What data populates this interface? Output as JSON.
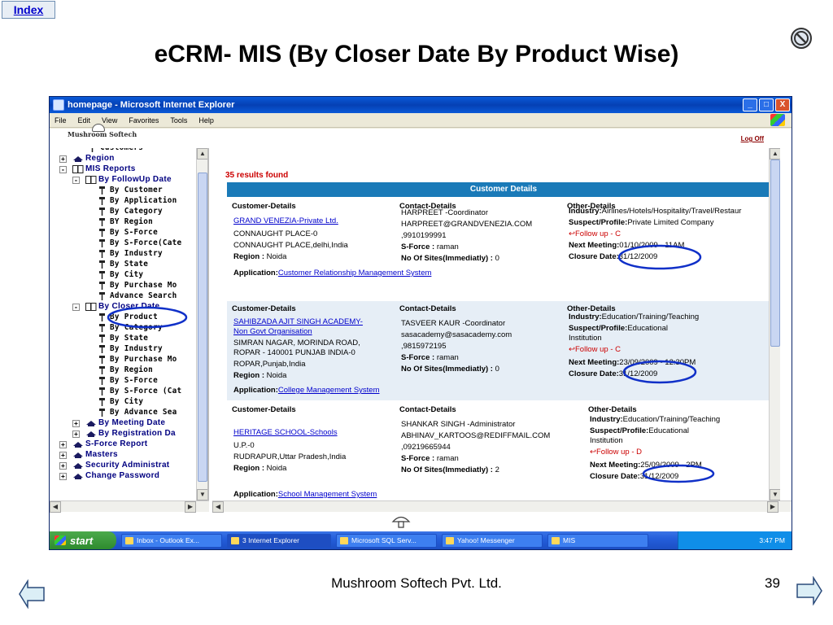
{
  "slide": {
    "index_label": "Index",
    "title": "eCRM- MIS (By Closer Date By Product Wise)",
    "footer_company": "Mushroom Softech Pvt. Ltd.",
    "page_number": "39"
  },
  "browser": {
    "window_title": "homepage - Microsoft Internet Explorer",
    "menu": [
      "File",
      "Edit",
      "View",
      "Favorites",
      "Tools",
      "Help"
    ],
    "window_buttons": [
      "_",
      "□",
      "X"
    ]
  },
  "app": {
    "logo_text": "Mushroom Softech",
    "logout_label": "Log Off"
  },
  "tree": [
    {
      "label": "Customers",
      "level": "leaf",
      "indent": 60,
      "type": "leaf"
    },
    {
      "label": "Region",
      "level": "lvl1",
      "indent": 28,
      "type": "node",
      "exp": "+"
    },
    {
      "label": "MIS Reports",
      "level": "lvl1",
      "indent": 28,
      "type": "book",
      "exp": "-"
    },
    {
      "label": "By FollowUp Date",
      "level": "lvl2",
      "indent": 44,
      "type": "book",
      "exp": "-"
    },
    {
      "label": "By Customer",
      "level": "leaf",
      "indent": 72,
      "type": "leaf"
    },
    {
      "label": "By Application",
      "level": "leaf",
      "indent": 72,
      "type": "leaf"
    },
    {
      "label": "By Category",
      "level": "leaf",
      "indent": 72,
      "type": "leaf"
    },
    {
      "label": "BY Region",
      "level": "leaf",
      "indent": 72,
      "type": "leaf"
    },
    {
      "label": "By S-Force",
      "level": "leaf",
      "indent": 72,
      "type": "leaf"
    },
    {
      "label": "By S-Force(Cate",
      "level": "leaf",
      "indent": 72,
      "type": "leaf"
    },
    {
      "label": "By Industry",
      "level": "leaf",
      "indent": 72,
      "type": "leaf"
    },
    {
      "label": "By State",
      "level": "leaf",
      "indent": 72,
      "type": "leaf"
    },
    {
      "label": "By City",
      "level": "leaf",
      "indent": 72,
      "type": "leaf"
    },
    {
      "label": "By Purchase Mo",
      "level": "leaf",
      "indent": 72,
      "type": "leaf"
    },
    {
      "label": "Advance Search",
      "level": "leaf",
      "indent": 72,
      "type": "leaf"
    },
    {
      "label": "By Closer Date",
      "level": "lvl2",
      "indent": 44,
      "type": "book",
      "exp": "-"
    },
    {
      "label": "By Product",
      "level": "leaf",
      "indent": 72,
      "type": "leaf"
    },
    {
      "label": "By Category",
      "level": "leaf",
      "indent": 72,
      "type": "leaf"
    },
    {
      "label": "By State",
      "level": "leaf",
      "indent": 72,
      "type": "leaf"
    },
    {
      "label": "By Industry",
      "level": "leaf",
      "indent": 72,
      "type": "leaf"
    },
    {
      "label": "By Purchase Mo",
      "level": "leaf",
      "indent": 72,
      "type": "leaf"
    },
    {
      "label": "By Region",
      "level": "leaf",
      "indent": 72,
      "type": "leaf"
    },
    {
      "label": "By S-Force",
      "level": "leaf",
      "indent": 72,
      "type": "leaf"
    },
    {
      "label": "By S-Force (Cat",
      "level": "leaf",
      "indent": 72,
      "type": "leaf"
    },
    {
      "label": "By City",
      "level": "leaf",
      "indent": 72,
      "type": "leaf"
    },
    {
      "label": "By Advance Sea",
      "level": "leaf",
      "indent": 72,
      "type": "leaf"
    },
    {
      "label": "By Meeting Date",
      "level": "lvl2",
      "indent": 44,
      "type": "node",
      "exp": "+"
    },
    {
      "label": "By Registration Da",
      "level": "lvl2",
      "indent": 44,
      "type": "node",
      "exp": "+"
    },
    {
      "label": "S-Force Report",
      "level": "lvl1",
      "indent": 28,
      "type": "node",
      "exp": "+"
    },
    {
      "label": "Masters",
      "level": "lvl1",
      "indent": 28,
      "type": "node",
      "exp": "+"
    },
    {
      "label": "Security Administrat",
      "level": "lvl1",
      "indent": 28,
      "type": "node",
      "exp": "+"
    },
    {
      "label": "Change Password",
      "level": "lvl1",
      "indent": 28,
      "type": "node",
      "exp": "+"
    }
  ],
  "content": {
    "results_text": "35 results found",
    "table_header": "Customer Details",
    "col_customer": "Customer-Details",
    "col_contact": "Contact-Details",
    "col_other": "Other-Details",
    "lbl_region": "Region :",
    "lbl_sforce": "S-Force :",
    "lbl_sites": "No Of Sites(Immediatly) :",
    "lbl_industry": "Industry:",
    "lbl_suspect": "Suspect/Profile:",
    "lbl_follow": "Follow up",
    "lbl_next": "Next Meeting:",
    "lbl_closure": "Closure Date:",
    "lbl_application": "Application:",
    "records": [
      {
        "company": "GRAND VENEZIA-Private Ltd.",
        "address1": "CONNAUGHT PLACE-0",
        "address2": "CONNAUGHT PLACE,delhi,India",
        "address3": "",
        "region": "Noida",
        "contact_name": "HARPREET -Coordinator",
        "email": "HARPREET@GRANDVENEZIA.COM",
        "phone": ",9910199991",
        "sforce": "raman",
        "sites": "0",
        "industry": "Airlines/Hotels/Hospitality/Travel/Restaur",
        "suspect": "Private Limited Company",
        "follow_grade": "- C",
        "next_meeting": "01/10/2009 - 11AM",
        "closure_date": "31/12/2009",
        "application": "Customer Relationship Management System"
      },
      {
        "company": "SAHIBZADA AJIT SINGH ACADEMY-",
        "company2": "Non Govt Organisation",
        "address1": "SIMRAN NAGAR, MORINDA ROAD,",
        "address2": "ROPAR - 140001 PUNJAB INDIA-0",
        "address3": "ROPAR,Punjab,India",
        "region": "Noida",
        "contact_name": "TASVEER KAUR -Coordinator",
        "email": "sasacademy@sasacademy.com",
        "phone": ",9815972195",
        "sforce": "raman",
        "sites": "0",
        "industry": "Education/Training/Teaching",
        "suspect": "Educational",
        "suspect2": "Institution",
        "follow_grade": "- C",
        "next_meeting": "23/09/2009 - 12:30PM",
        "closure_date": "31/12/2009",
        "application": "College Management System"
      },
      {
        "company": "HERITAGE SCHOOL-Schools",
        "address1": "U.P.-0",
        "address2": "RUDRAPUR,Uttar Pradesh,India",
        "address3": "",
        "region": "Noida",
        "contact_name": "SHANKAR SINGH -Administrator",
        "email": "ABHINAV_KARTOOS@REDIFFMAIL.COM",
        "phone": ",09219665944",
        "sforce": "raman",
        "sites": "2",
        "industry": "Education/Training/Teaching",
        "suspect": "Educational",
        "suspect2": "Institution",
        "follow_grade": "- D",
        "next_meeting": "25/09/2009 - 2PM",
        "closure_date": "31/12/2009",
        "application": "School Management System"
      }
    ]
  },
  "taskbar": {
    "start_label": "start",
    "tasks": [
      "Inbox - Outlook Ex...",
      "3 Internet Explorer",
      "Microsoft SQL Serv...",
      "Yahoo! Messenger",
      "MIS"
    ],
    "clock": "3:47 PM"
  },
  "colors": {
    "table_header": "#1a7ab8",
    "results": "#cc0000",
    "annotation_circle": "#1030c8",
    "tree_text": "#000080"
  }
}
